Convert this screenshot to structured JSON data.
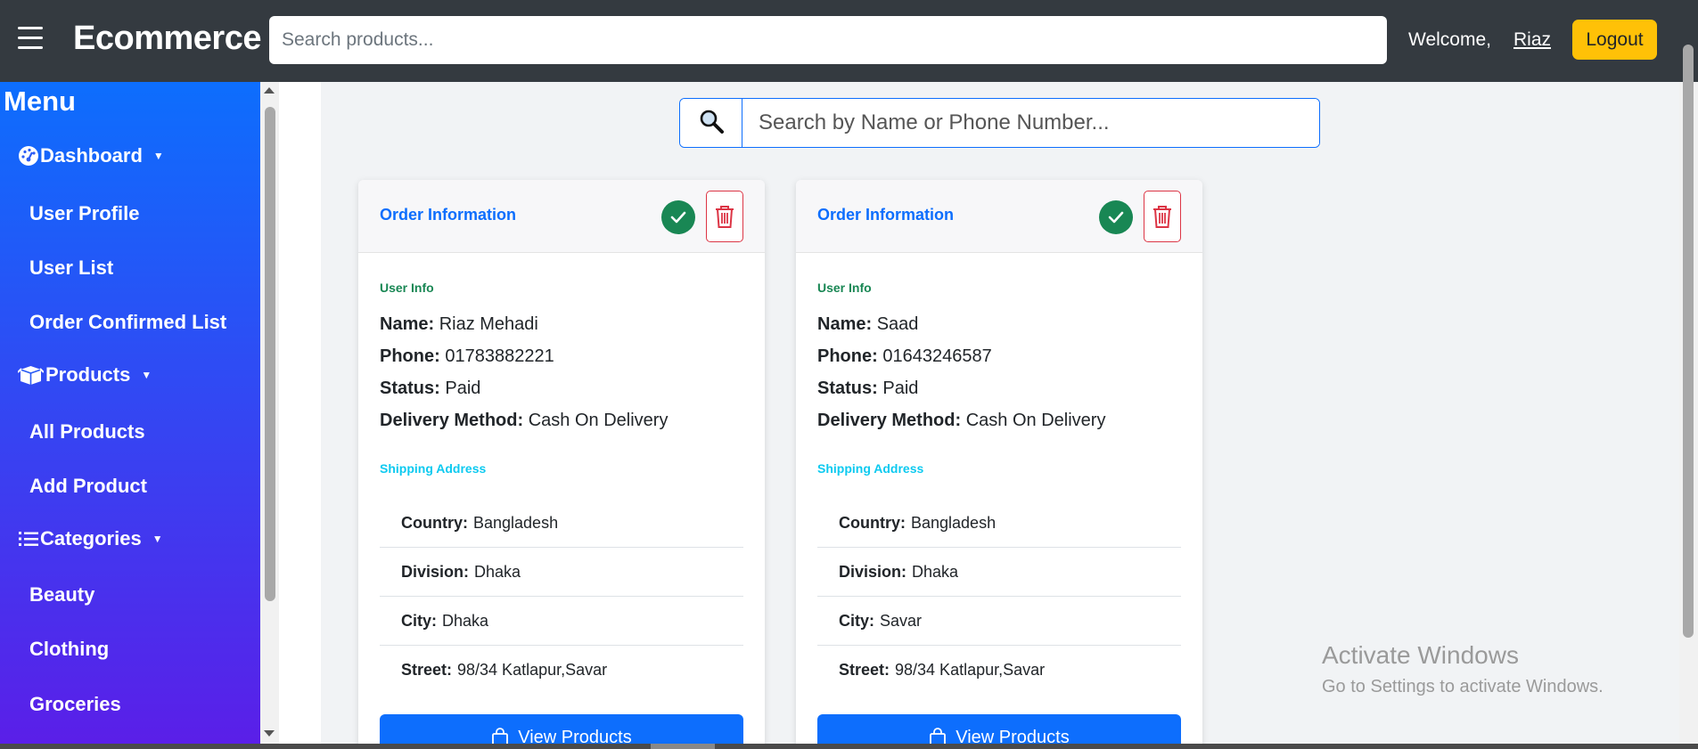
{
  "navbar": {
    "brand": "Ecommerce",
    "search_placeholder": "Search products...",
    "welcome": "Welcome,",
    "username": "Riaz",
    "logout_label": "Logout"
  },
  "sidebar": {
    "title": "Menu",
    "items": [
      {
        "label": "Dashboard",
        "icon": "dashboard-gauge-icon",
        "has_caret": true
      },
      {
        "label": "User Profile"
      },
      {
        "label": "User List"
      },
      {
        "label": "Order Confirmed List"
      },
      {
        "label": "Products",
        "icon": "box-icon",
        "has_caret": true
      },
      {
        "label": "All Products"
      },
      {
        "label": "Add Product"
      },
      {
        "label": "Categories",
        "icon": "list-icon",
        "has_caret": true
      },
      {
        "label": "Beauty"
      },
      {
        "label": "Clothing"
      },
      {
        "label": "Groceries"
      }
    ]
  },
  "main_search": {
    "placeholder": "Search by Name or Phone Number...",
    "icon": "magnifier-icon"
  },
  "orders": [
    {
      "header": "Order Information",
      "user_info_label": "User Info",
      "name_label": "Name:",
      "name": "Riaz Mehadi",
      "phone_label": "Phone:",
      "phone": "01783882221",
      "status_label": "Status:",
      "status": "Paid",
      "delivery_label": "Delivery Method:",
      "delivery": "Cash On Delivery",
      "shipping_label": "Shipping Address",
      "country_label": "Country:",
      "country": "Bangladesh",
      "division_label": "Division:",
      "division": "Dhaka",
      "city_label": "City:",
      "city": "Dhaka",
      "street_label": "Street:",
      "street": "98/34 Katlapur,Savar",
      "view_label": "View Products"
    },
    {
      "header": "Order Information",
      "user_info_label": "User Info",
      "name_label": "Name:",
      "name": "Saad",
      "phone_label": "Phone:",
      "phone": "01643246587",
      "status_label": "Status:",
      "status": "Paid",
      "delivery_label": "Delivery Method:",
      "delivery": "Cash On Delivery",
      "shipping_label": "Shipping Address",
      "country_label": "Country:",
      "country": "Bangladesh",
      "division_label": "Division:",
      "division": "Dhaka",
      "city_label": "City:",
      "city": "Savar",
      "street_label": "Street:",
      "street": "98/34 Katlapur,Savar",
      "view_label": "View Products"
    }
  ],
  "watermark": {
    "title": "Activate Windows",
    "subtitle": "Go to Settings to activate Windows."
  },
  "colors": {
    "navbar": "#343a40",
    "accent": "#0d6efd",
    "logout": "#ffc107",
    "confirm": "#198754",
    "delete": "#dc3545",
    "sidebar_top": "#0d6efd",
    "sidebar_bottom": "#5b1ee8"
  }
}
